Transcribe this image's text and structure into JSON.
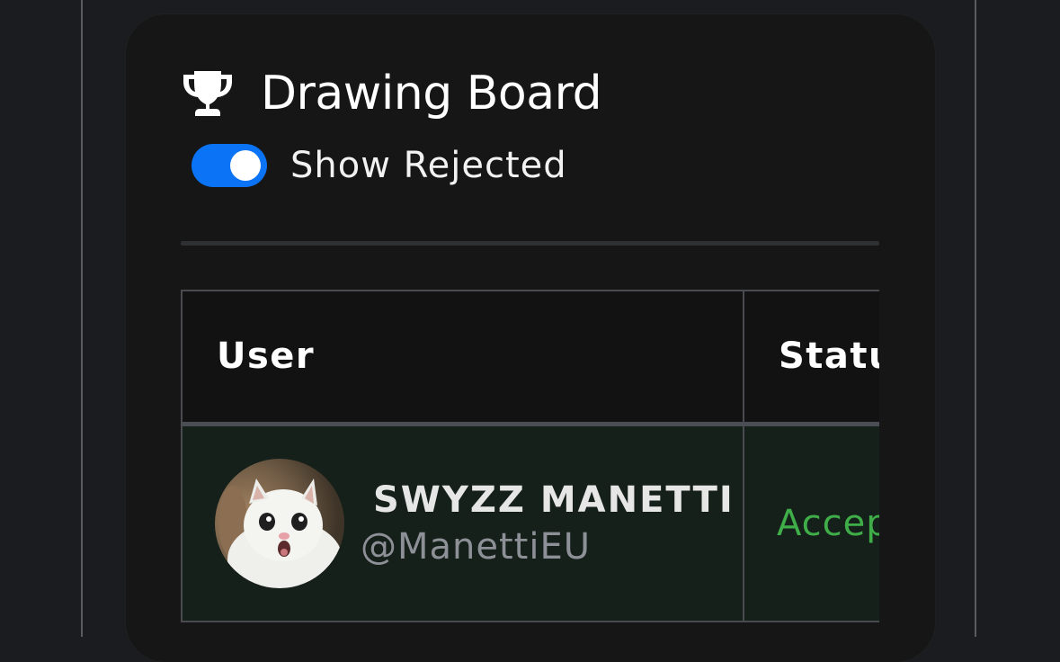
{
  "card": {
    "title": "Drawing Board",
    "title_icon": "trophy-icon"
  },
  "toggle": {
    "label": "Show Rejected",
    "checked": true,
    "color": "#0b73f5"
  },
  "table": {
    "columns": [
      "User",
      "Status"
    ],
    "rows": [
      {
        "name": "SWYZZ MANETTI",
        "handle": "@ManettiEU",
        "status": "Accepted",
        "avatar": "cat-avatar-image"
      }
    ]
  },
  "colors": {
    "accepted": "#3fae49",
    "row_background": "#16201a"
  }
}
